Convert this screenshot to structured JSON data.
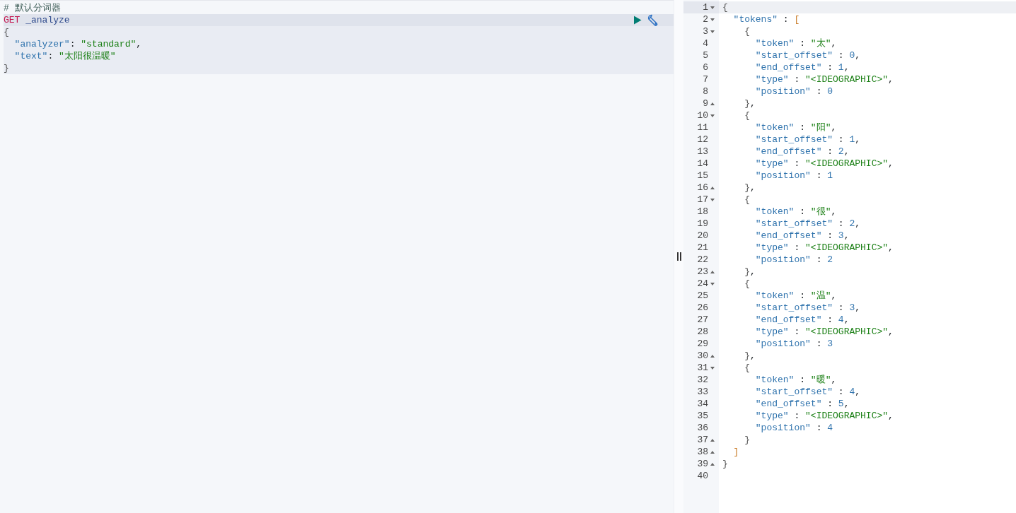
{
  "request_editor": {
    "lines": [
      {
        "text": "# 默认分词器",
        "kind": "comment",
        "in_request": false,
        "active": false
      },
      {
        "text": "GET _analyze",
        "kind": "request",
        "in_request": true,
        "active": true
      },
      {
        "text": "{",
        "kind": "json",
        "in_request": true,
        "active": false
      },
      {
        "text": "  \"analyzer\": \"standard\",",
        "kind": "json",
        "in_request": true,
        "active": false
      },
      {
        "text": "  \"text\": \"太阳很温暖\"",
        "kind": "json",
        "in_request": true,
        "active": false
      },
      {
        "text": "}",
        "kind": "json",
        "in_request": true,
        "active": false
      }
    ]
  },
  "response_viewer": {
    "lines": [
      {
        "number": "1",
        "text": "{",
        "fold_start": true,
        "active": true
      },
      {
        "number": "2",
        "text": "  \"tokens\" : [",
        "fold_start": true,
        "active": false
      },
      {
        "number": "3",
        "text": "    {",
        "fold_start": true,
        "active": false
      },
      {
        "number": "4",
        "text": "      \"token\" : \"太\",",
        "active": false
      },
      {
        "number": "5",
        "text": "      \"start_offset\" : 0,",
        "active": false
      },
      {
        "number": "6",
        "text": "      \"end_offset\" : 1,",
        "active": false
      },
      {
        "number": "7",
        "text": "      \"type\" : \"<IDEOGRAPHIC>\",",
        "active": false
      },
      {
        "number": "8",
        "text": "      \"position\" : 0",
        "active": false
      },
      {
        "number": "9",
        "text": "    },",
        "fold_end": true,
        "active": false
      },
      {
        "number": "10",
        "text": "    {",
        "fold_start": true,
        "active": false
      },
      {
        "number": "11",
        "text": "      \"token\" : \"阳\",",
        "active": false
      },
      {
        "number": "12",
        "text": "      \"start_offset\" : 1,",
        "active": false
      },
      {
        "number": "13",
        "text": "      \"end_offset\" : 2,",
        "active": false
      },
      {
        "number": "14",
        "text": "      \"type\" : \"<IDEOGRAPHIC>\",",
        "active": false
      },
      {
        "number": "15",
        "text": "      \"position\" : 1",
        "active": false
      },
      {
        "number": "16",
        "text": "    },",
        "fold_end": true,
        "active": false
      },
      {
        "number": "17",
        "text": "    {",
        "fold_start": true,
        "active": false
      },
      {
        "number": "18",
        "text": "      \"token\" : \"很\",",
        "active": false
      },
      {
        "number": "19",
        "text": "      \"start_offset\" : 2,",
        "active": false
      },
      {
        "number": "20",
        "text": "      \"end_offset\" : 3,",
        "active": false
      },
      {
        "number": "21",
        "text": "      \"type\" : \"<IDEOGRAPHIC>\",",
        "active": false
      },
      {
        "number": "22",
        "text": "      \"position\" : 2",
        "active": false
      },
      {
        "number": "23",
        "text": "    },",
        "fold_end": true,
        "active": false
      },
      {
        "number": "24",
        "text": "    {",
        "fold_start": true,
        "active": false
      },
      {
        "number": "25",
        "text": "      \"token\" : \"温\",",
        "active": false
      },
      {
        "number": "26",
        "text": "      \"start_offset\" : 3,",
        "active": false
      },
      {
        "number": "27",
        "text": "      \"end_offset\" : 4,",
        "active": false
      },
      {
        "number": "28",
        "text": "      \"type\" : \"<IDEOGRAPHIC>\",",
        "active": false
      },
      {
        "number": "29",
        "text": "      \"position\" : 3",
        "active": false
      },
      {
        "number": "30",
        "text": "    },",
        "fold_end": true,
        "active": false
      },
      {
        "number": "31",
        "text": "    {",
        "fold_start": true,
        "active": false
      },
      {
        "number": "32",
        "text": "      \"token\" : \"暖\",",
        "active": false
      },
      {
        "number": "33",
        "text": "      \"start_offset\" : 4,",
        "active": false
      },
      {
        "number": "34",
        "text": "      \"end_offset\" : 5,",
        "active": false
      },
      {
        "number": "35",
        "text": "      \"type\" : \"<IDEOGRAPHIC>\",",
        "active": false
      },
      {
        "number": "36",
        "text": "      \"position\" : 4",
        "active": false
      },
      {
        "number": "37",
        "text": "    }",
        "fold_end": true,
        "active": false
      },
      {
        "number": "38",
        "text": "  ]",
        "fold_end": true,
        "active": false
      },
      {
        "number": "39",
        "text": "}",
        "fold_end": true,
        "active": false
      },
      {
        "number": "40",
        "active": false
      }
    ]
  }
}
